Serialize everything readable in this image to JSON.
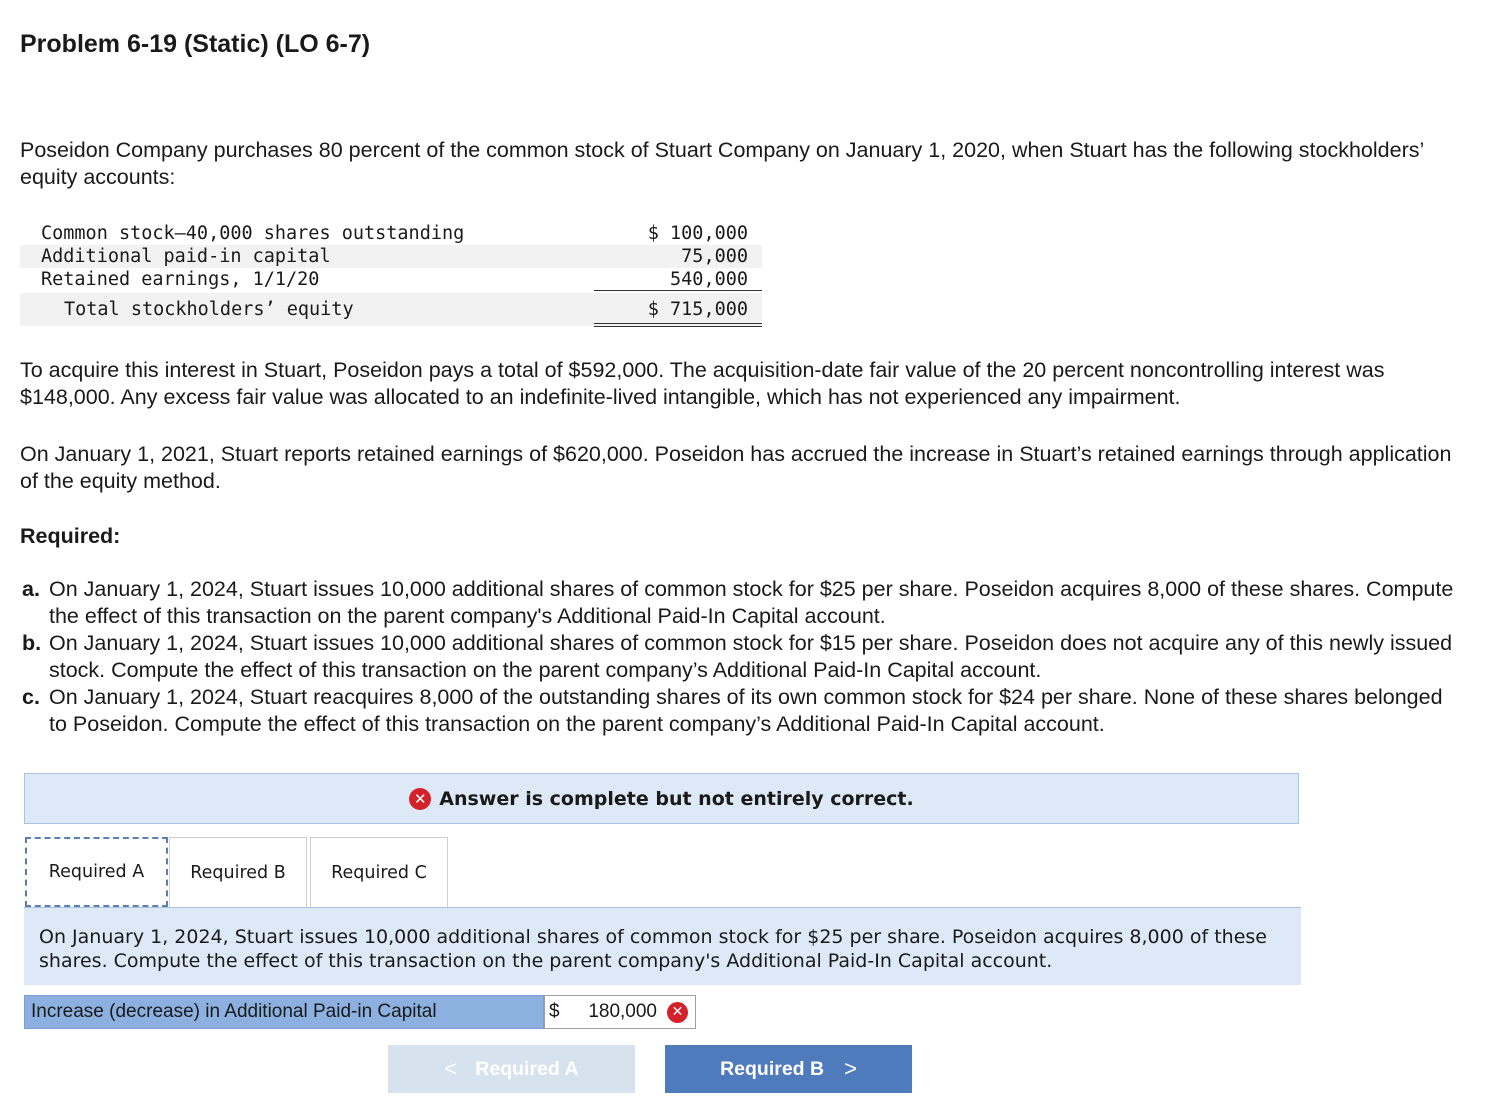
{
  "title": "Problem 6-19 (Static) (LO 6-7)",
  "intro": "Poseidon Company purchases 80 percent of the common stock of Stuart Company on January 1, 2020, when Stuart has the following stockholders’ equity accounts:",
  "equity": {
    "rows": [
      {
        "label": "Common stock—40,000 shares outstanding",
        "value": "$ 100,000"
      },
      {
        "label": "Additional paid-in capital",
        "value": "75,000"
      },
      {
        "label": "Retained earnings, 1/1/20",
        "value": "540,000"
      }
    ],
    "total": {
      "label": "Total stockholders’ equity",
      "value": "$ 715,000"
    }
  },
  "para2": "To acquire this interest in Stuart, Poseidon pays a total of $592,000. The acquisition-date fair value of the 20 percent noncontrolling interest was $148,000. Any excess fair value was allocated to an indefinite-lived intangible, which has not experienced any impairment.",
  "para3": "On January 1, 2021, Stuart reports retained earnings of $620,000. Poseidon has accrued the increase in Stuart’s retained earnings through application of the equity method.",
  "required_heading": "Required:",
  "requirements": [
    {
      "mark": "a.",
      "text": "On January 1, 2024, Stuart issues 10,000 additional shares of common stock for $25 per share. Poseidon acquires 8,000 of these shares. Compute the effect of this transaction on the parent company's Additional Paid-In Capital account."
    },
    {
      "mark": "b.",
      "text": "On January 1, 2024, Stuart issues 10,000 additional shares of common stock for $15 per share. Poseidon does not acquire any of this newly issued stock. Compute the effect of this transaction on the parent company’s Additional Paid-In Capital account."
    },
    {
      "mark": "c.",
      "text": "On January 1, 2024, Stuart reacquires 8,000 of the outstanding shares of its own common stock for $24 per share. None of these shares belonged to Poseidon. Compute the effect of this transaction on the parent company’s Additional Paid-In Capital account."
    }
  ],
  "banner": {
    "icon": "x-circle-icon",
    "text": "Answer is complete but not entirely correct."
  },
  "tabs": [
    {
      "label": "Required A"
    },
    {
      "label": "Required B"
    },
    {
      "label": "Required C"
    }
  ],
  "question": "On January 1, 2024, Stuart issues 10,000 additional shares of common stock for $25 per share. Poseidon acquires 8,000 of these shares. Compute the effect of this transaction on the parent company's Additional Paid-In Capital account.",
  "answer": {
    "label": "Increase (decrease) in Additional Paid-in Capital",
    "currency": "$",
    "value": "180,000",
    "status_icon": "x-circle-icon"
  },
  "nav": {
    "prev_label": "Required A",
    "next_label": "Required B",
    "prev_chevron": "<",
    "next_chevron": ">"
  },
  "colors": {
    "banner_bg": "#dde9f6",
    "error_red": "#d4222a",
    "next_button": "#4f7bbd",
    "prev_button_disabled": "#d7e2ef",
    "answer_label_bg": "#8cb0e0"
  }
}
